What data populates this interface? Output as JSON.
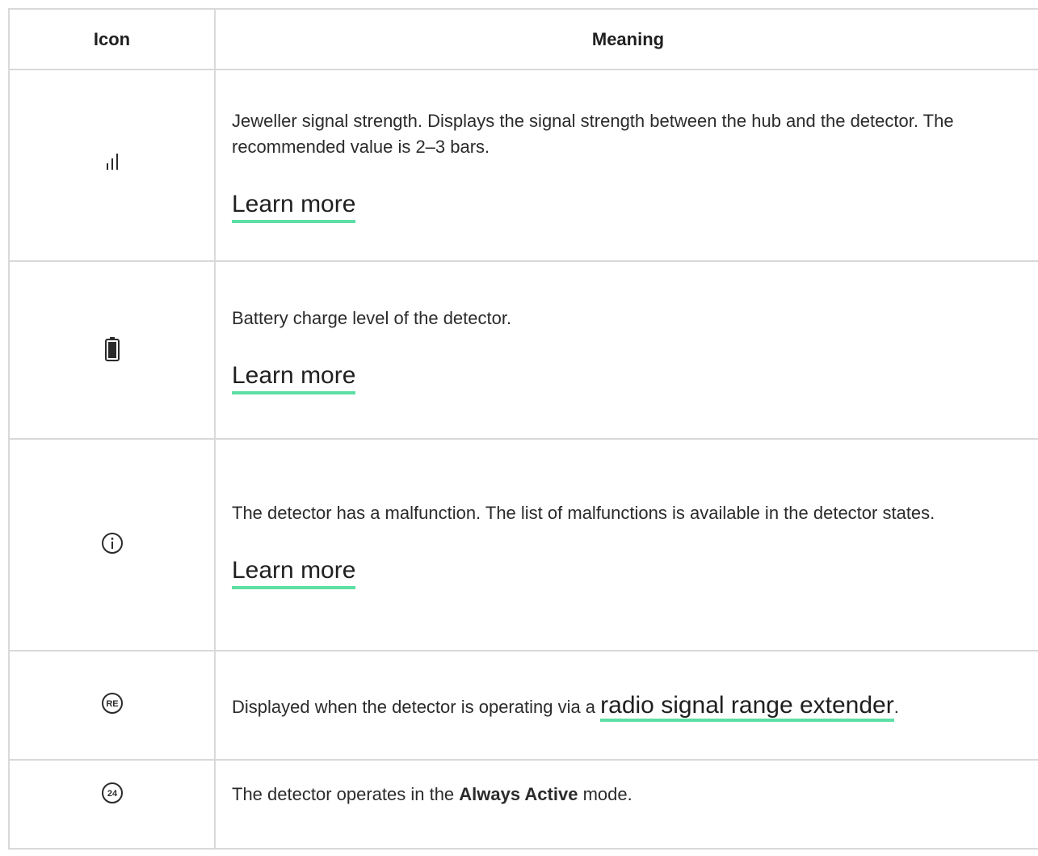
{
  "table": {
    "headers": {
      "icon": "Icon",
      "meaning": "Meaning"
    },
    "rows": [
      {
        "icon": "signal-strength-icon",
        "text": "Jeweller signal strength. Displays the signal strength between the hub and the detector. The recommended value is 2–3 bars.",
        "link": "Learn more"
      },
      {
        "icon": "battery-icon",
        "text": "Battery charge level of the detector.",
        "link": "Learn more"
      },
      {
        "icon": "info-icon",
        "text": "The detector has a malfunction. The list of malfunctions is available in the detector states.",
        "link": "Learn more"
      },
      {
        "icon": "re-icon",
        "icon_label": "RE",
        "text_before": "Displayed when the detector is operating via a ",
        "link": "radio signal range extender",
        "text_after": "."
      },
      {
        "icon": "always-active-24-icon",
        "icon_label": "24",
        "text_before": "The detector operates in the ",
        "text_bold": "Always Active",
        "text_after": " mode."
      }
    ]
  },
  "colors": {
    "border": "#d9d9d9",
    "link_underline": "#5ddfa4",
    "text": "#2b2b2b"
  }
}
